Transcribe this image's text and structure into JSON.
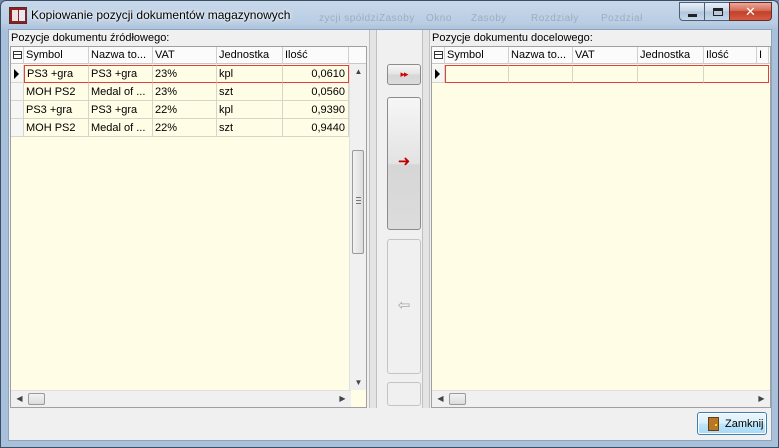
{
  "window": {
    "title": "Kopiowanie pozycji dokumentów magazynowych",
    "ghost_menu": [
      "zycji spółdzi",
      "Zasoby",
      "Okno",
      "Zasoby",
      "Rozdziały",
      "Pozdział"
    ]
  },
  "caption": {
    "minimize": "–",
    "maximize": "□",
    "close": "✕"
  },
  "source": {
    "label": "Pozycje dokumentu źródłowego:",
    "columns": [
      "Symbol",
      "Nazwa to...",
      "VAT",
      "Jednostka",
      "Ilość"
    ],
    "rows": [
      [
        "PS3 +gra",
        "PS3 +gra",
        "23%",
        "kpl",
        "0,0610"
      ],
      [
        "MOH PS2",
        "Medal of ...",
        "23%",
        "szt",
        "0,0560"
      ],
      [
        "PS3 +gra",
        "PS3 +gra",
        "22%",
        "kpl",
        "0,9390"
      ],
      [
        "MOH PS2",
        "Medal of ...",
        "22%",
        "szt",
        "0,9440"
      ]
    ]
  },
  "target": {
    "label": "Pozycje dokumentu docelowego:",
    "columns": [
      "Symbol",
      "Nazwa to...",
      "VAT",
      "Jednostka",
      "Ilość",
      "I"
    ]
  },
  "buttons": {
    "copy_all": "▸▸",
    "copy_one": "➜",
    "remove_one": "⇦",
    "close": "Zamknij"
  },
  "scroll": {
    "up": "▲",
    "down": "▼",
    "left": "◀",
    "right": "▶"
  }
}
